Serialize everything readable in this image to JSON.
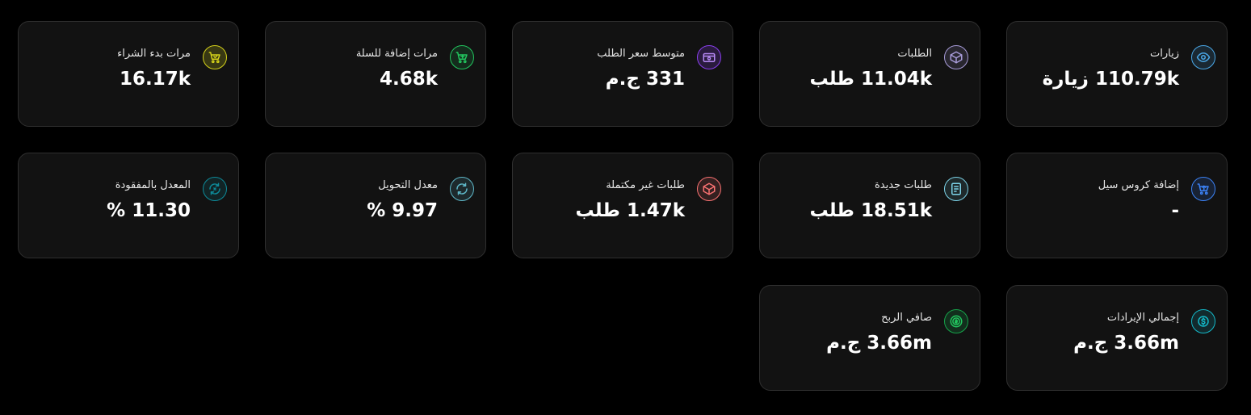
{
  "colors": {
    "background": "#000000",
    "card": "#121212",
    "card_border": "#2f2f2f",
    "text": "#ffffff"
  },
  "cards": [
    {
      "id": "visits",
      "label": "زيارات",
      "value": "110.79k زيارة",
      "icon": "eye-icon",
      "color": "#4aa8e8"
    },
    {
      "id": "orders",
      "label": "الطلبات",
      "value": "11.04k طلب",
      "icon": "package-icon",
      "color": "#a79bd8"
    },
    {
      "id": "avg-order-price",
      "label": "متوسط سعر الطلب",
      "value": "331 ج.م",
      "icon": "wallet-icon",
      "color": "#8b3ff0"
    },
    {
      "id": "add-to-cart",
      "label": "مرات إضافة للسلة",
      "value": "4.68k",
      "icon": "cart-add-icon",
      "color": "#22c55e"
    },
    {
      "id": "checkout-starts",
      "label": "مرات بدء الشراء",
      "value": "16.17k",
      "icon": "cart-check-icon",
      "color": "#d4d11a"
    },
    {
      "id": "cross-sell",
      "label": "إضافة كروس سيل",
      "value": "-",
      "icon": "cart-upload-icon",
      "color": "#3b82f6"
    },
    {
      "id": "new-orders",
      "label": "طلبات جديدة",
      "value": "18.51k طلب",
      "icon": "receipt-icon",
      "color": "#7dd3e8"
    },
    {
      "id": "incomplete-orders",
      "label": "طلبات غير مكتملة",
      "value": "1.47k طلب",
      "icon": "box-x-icon",
      "color": "#f87171"
    },
    {
      "id": "conversion-rate",
      "label": "معدل التحويل",
      "value": "9.97 %",
      "icon": "refresh-icon",
      "color": "#5fb8c9"
    },
    {
      "id": "lost-rate",
      "label": "المعدل بالمفقودة",
      "value": "11.30 %",
      "icon": "refresh-x-icon",
      "color": "#0e8a99"
    },
    {
      "id": "total-revenue",
      "label": "إجمالي الإيرادات",
      "value": "3.66m ج.م",
      "icon": "dollar-circle-icon",
      "color": "#14b8c8"
    },
    {
      "id": "net-profit",
      "label": "صافي الربح",
      "value": "3.66m ج.م",
      "icon": "dollar-coin-icon",
      "color": "#16a34a"
    }
  ]
}
